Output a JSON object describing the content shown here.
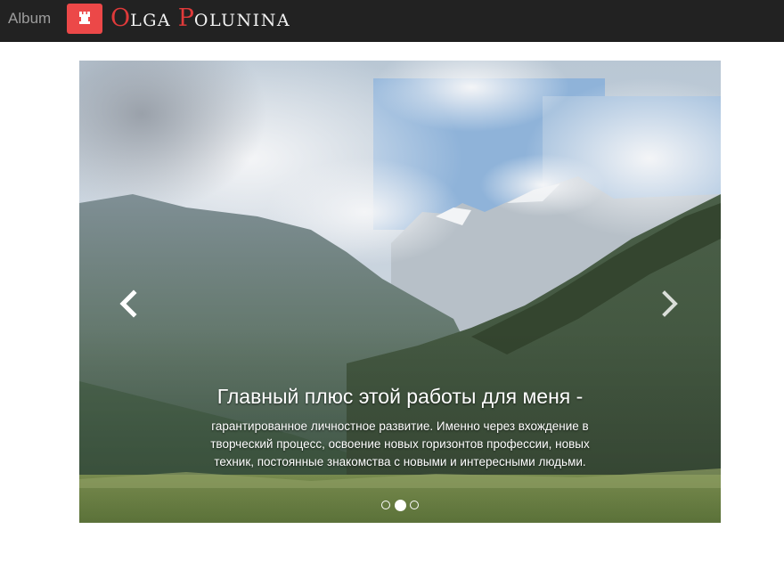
{
  "navbar": {
    "brand_link": "Album",
    "logo_icon": "rook-icon",
    "logo_first_initial": "O",
    "logo_first_rest": "LGA",
    "logo_last_initial": "P",
    "logo_last_rest": "OLUNINA"
  },
  "carousel": {
    "slide": {
      "image": "mountain-valley-photo",
      "caption_title": "Главный плюс этой работы для меня -",
      "caption_text": "гарантированное личностное развитие. Именно через вхождение в творческий процесс, освоение новых горизонтов профессии, новых техник, постоянные знакомства с новыми и интересными людьми."
    },
    "controls": {
      "prev_icon": "chevron-left-icon",
      "next_icon": "chevron-right-icon"
    },
    "indicators": {
      "count": 3,
      "active_index": 1
    }
  }
}
